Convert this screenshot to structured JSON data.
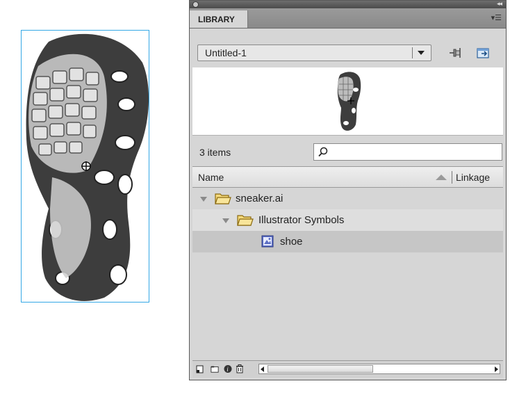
{
  "library": {
    "tab_label": "LIBRARY",
    "document_select": "Untitled-1",
    "items_count": "3 items",
    "search": {
      "value": ""
    },
    "columns": {
      "name": "Name",
      "linkage": "Linkage"
    },
    "items": [
      {
        "label": "sneaker.ai",
        "type": "folder",
        "expanded": true,
        "indent": 0
      },
      {
        "label": "Illustrator Symbols",
        "type": "folder",
        "expanded": true,
        "indent": 1
      },
      {
        "label": "shoe",
        "type": "movie-clip-symbol",
        "selected": true,
        "indent": 2
      }
    ]
  },
  "icons": {
    "panel_menu": "panel-menu-icon",
    "pin": "pin-library-icon",
    "new_library": "new-library-panel-icon",
    "search": "search-icon",
    "folder": "folder-icon",
    "symbol": "movie-clip-symbol-icon",
    "new_symbol": "new-symbol-icon",
    "new_folder": "new-folder-icon",
    "properties": "properties-icon",
    "delete": "trash-icon"
  },
  "colors": {
    "selection": "#34a8e6",
    "panel_bg": "#d6d6d6",
    "selected_row": "#c6c6c6"
  }
}
